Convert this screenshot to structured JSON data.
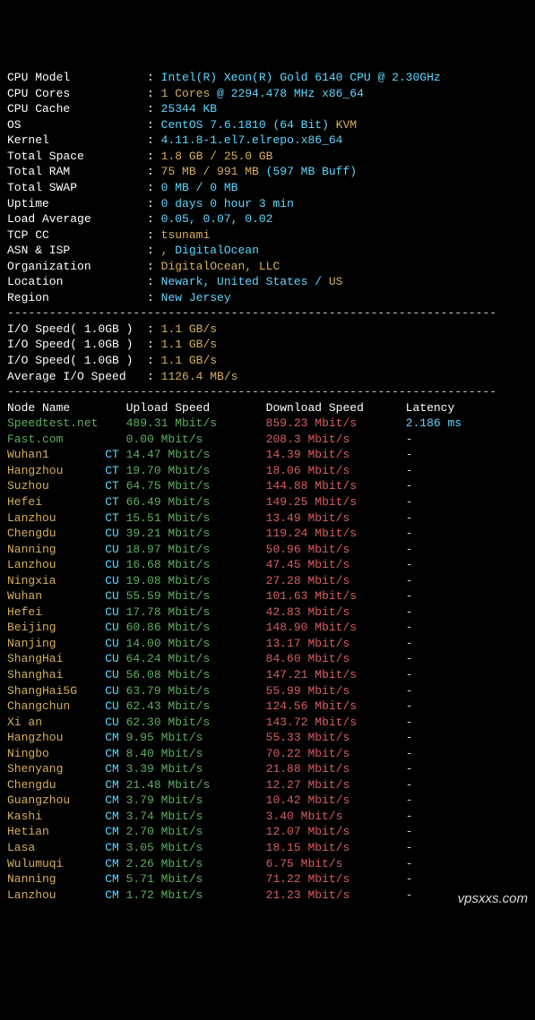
{
  "sysinfo": [
    {
      "label": "CPU Model",
      "val": [
        {
          "t": "Intel(R) Xeon(R) Gold 6140 CPU @ 2.30GHz",
          "c": "cyan"
        }
      ]
    },
    {
      "label": "CPU Cores",
      "val": [
        {
          "t": "1 Cores",
          "c": "yellow"
        },
        {
          "t": " @ 2294.478 MHz x86_64",
          "c": "cyan"
        }
      ]
    },
    {
      "label": "CPU Cache",
      "val": [
        {
          "t": "25344 KB",
          "c": "cyan"
        }
      ]
    },
    {
      "label": "OS",
      "val": [
        {
          "t": "CentOS 7.6.1810 (64 Bit)",
          "c": "cyan"
        },
        {
          "t": " KVM",
          "c": "yellow"
        }
      ]
    },
    {
      "label": "Kernel",
      "val": [
        {
          "t": "4.11.8-1.el7.elrepo.x86_64",
          "c": "cyan"
        }
      ]
    },
    {
      "label": "Total Space",
      "val": [
        {
          "t": "1.8 GB / 25.0 GB",
          "c": "yellow"
        }
      ]
    },
    {
      "label": "Total RAM",
      "val": [
        {
          "t": "75 MB / 991 MB",
          "c": "yellow"
        },
        {
          "t": " (597 MB Buff)",
          "c": "cyan"
        }
      ]
    },
    {
      "label": "Total SWAP",
      "val": [
        {
          "t": "0 MB / 0 MB",
          "c": "cyan"
        }
      ]
    },
    {
      "label": "Uptime",
      "val": [
        {
          "t": "0 days 0 hour 3 min",
          "c": "cyan"
        }
      ]
    },
    {
      "label": "Load Average",
      "val": [
        {
          "t": "0.05, 0.07, 0.02",
          "c": "cyan"
        }
      ]
    },
    {
      "label": "TCP CC",
      "val": [
        {
          "t": "tsunami",
          "c": "yellow"
        }
      ]
    },
    {
      "label": "ASN & ISP",
      "val": [
        {
          "t": ", ",
          "c": "yellow"
        },
        {
          "t": "DigitalOcean",
          "c": "cyan"
        }
      ]
    },
    {
      "label": "Organization",
      "val": [
        {
          "t": "DigitalOcean, LLC",
          "c": "yellow"
        }
      ]
    },
    {
      "label": "Location",
      "val": [
        {
          "t": "Newark, United States / ",
          "c": "cyan"
        },
        {
          "t": "US",
          "c": "yellow"
        }
      ]
    },
    {
      "label": "Region",
      "val": [
        {
          "t": "New Jersey",
          "c": "cyan"
        }
      ]
    }
  ],
  "io": {
    "rows": [
      {
        "label": "I/O Speed( 1.0GB )",
        "val": "1.1 GB/s"
      },
      {
        "label": "I/O Speed( 1.0GB )",
        "val": "1.1 GB/s"
      },
      {
        "label": "I/O Speed( 1.0GB )",
        "val": "1.1 GB/s"
      }
    ],
    "avg_label": "Average I/O Speed",
    "avg_val": "1126.4 MB/s"
  },
  "headers": {
    "node": "Node Name",
    "upload": "Upload Speed",
    "download": "Download Speed",
    "latency": "Latency"
  },
  "speed": [
    {
      "name": "Speedtest.net",
      "tag": "",
      "up": "489.31 Mbit/s",
      "down": "859.23 Mbit/s",
      "lat": "2.186 ms",
      "namec": "green",
      "latc": "cyan"
    },
    {
      "name": "Fast.com",
      "tag": "",
      "up": "0.00 Mbit/s",
      "down": "208.3 Mbit/s",
      "lat": "-",
      "namec": "green",
      "latc": "grey"
    },
    {
      "name": "Wuhan1",
      "tag": "CT",
      "up": "14.47 Mbit/s",
      "down": "14.39 Mbit/s",
      "lat": "-",
      "namec": "yellow",
      "latc": "grey"
    },
    {
      "name": "Hangzhou",
      "tag": "CT",
      "up": "19.70 Mbit/s",
      "down": "18.06 Mbit/s",
      "lat": "-",
      "namec": "yellow",
      "latc": "grey"
    },
    {
      "name": "Suzhou",
      "tag": "CT",
      "up": "64.75 Mbit/s",
      "down": "144.88 Mbit/s",
      "lat": "-",
      "namec": "yellow",
      "latc": "grey"
    },
    {
      "name": "Hefei",
      "tag": "CT",
      "up": "66.49 Mbit/s",
      "down": "149.25 Mbit/s",
      "lat": "-",
      "namec": "yellow",
      "latc": "grey"
    },
    {
      "name": "Lanzhou",
      "tag": "CT",
      "up": "15.51 Mbit/s",
      "down": "13.49 Mbit/s",
      "lat": "-",
      "namec": "yellow",
      "latc": "grey"
    },
    {
      "name": "Chengdu",
      "tag": "CU",
      "up": "39.21 Mbit/s",
      "down": "119.24 Mbit/s",
      "lat": "-",
      "namec": "yellow",
      "latc": "grey"
    },
    {
      "name": "Nanning",
      "tag": "CU",
      "up": "18.97 Mbit/s",
      "down": "50.96 Mbit/s",
      "lat": "-",
      "namec": "yellow",
      "latc": "grey"
    },
    {
      "name": "Lanzhou",
      "tag": "CU",
      "up": "16.68 Mbit/s",
      "down": "47.45 Mbit/s",
      "lat": "-",
      "namec": "yellow",
      "latc": "grey"
    },
    {
      "name": "Ningxia",
      "tag": "CU",
      "up": "19.08 Mbit/s",
      "down": "27.28 Mbit/s",
      "lat": "-",
      "namec": "yellow",
      "latc": "grey"
    },
    {
      "name": "Wuhan",
      "tag": "CU",
      "up": "55.59 Mbit/s",
      "down": "101.63 Mbit/s",
      "lat": "-",
      "namec": "yellow",
      "latc": "grey"
    },
    {
      "name": "Hefei",
      "tag": "CU",
      "up": "17.78 Mbit/s",
      "down": "42.83 Mbit/s",
      "lat": "-",
      "namec": "yellow",
      "latc": "grey"
    },
    {
      "name": "Beijing",
      "tag": "CU",
      "up": "60.86 Mbit/s",
      "down": "148.90 Mbit/s",
      "lat": "-",
      "namec": "yellow",
      "latc": "grey"
    },
    {
      "name": "Nanjing",
      "tag": "CU",
      "up": "14.00 Mbit/s",
      "down": "13.17 Mbit/s",
      "lat": "-",
      "namec": "yellow",
      "latc": "grey"
    },
    {
      "name": "ShangHai",
      "tag": "CU",
      "up": "64.24 Mbit/s",
      "down": "84.60 Mbit/s",
      "lat": "-",
      "namec": "yellow",
      "latc": "grey"
    },
    {
      "name": "Shanghai",
      "tag": "CU",
      "up": "56.08 Mbit/s",
      "down": "147.21 Mbit/s",
      "lat": "-",
      "namec": "yellow",
      "latc": "grey"
    },
    {
      "name": "ShangHai5G",
      "tag": "CU",
      "up": "63.79 Mbit/s",
      "down": "55.99 Mbit/s",
      "lat": "-",
      "namec": "yellow",
      "latc": "grey"
    },
    {
      "name": "Changchun",
      "tag": "CU",
      "up": "62.43 Mbit/s",
      "down": "124.56 Mbit/s",
      "lat": "-",
      "namec": "yellow",
      "latc": "grey"
    },
    {
      "name": "Xi an",
      "tag": "CU",
      "up": "62.30 Mbit/s",
      "down": "143.72 Mbit/s",
      "lat": "-",
      "namec": "yellow",
      "latc": "grey"
    },
    {
      "name": "Hangzhou",
      "tag": "CM",
      "up": "9.95 Mbit/s",
      "down": "55.33 Mbit/s",
      "lat": "-",
      "namec": "yellow",
      "latc": "grey"
    },
    {
      "name": "Ningbo",
      "tag": "CM",
      "up": "8.40 Mbit/s",
      "down": "70.22 Mbit/s",
      "lat": "-",
      "namec": "yellow",
      "latc": "grey"
    },
    {
      "name": "Shenyang",
      "tag": "CM",
      "up": "3.39 Mbit/s",
      "down": "21.88 Mbit/s",
      "lat": "-",
      "namec": "yellow",
      "latc": "grey"
    },
    {
      "name": "Chengdu",
      "tag": "CM",
      "up": "21.48 Mbit/s",
      "down": "12.27 Mbit/s",
      "lat": "-",
      "namec": "yellow",
      "latc": "grey"
    },
    {
      "name": "Guangzhou",
      "tag": "CM",
      "up": "3.79 Mbit/s",
      "down": "10.42 Mbit/s",
      "lat": "-",
      "namec": "yellow",
      "latc": "grey"
    },
    {
      "name": "Kashi",
      "tag": "CM",
      "up": "3.74 Mbit/s",
      "down": "3.40 Mbit/s",
      "lat": "-",
      "namec": "yellow",
      "latc": "grey"
    },
    {
      "name": "Hetian",
      "tag": "CM",
      "up": "2.70 Mbit/s",
      "down": "12.07 Mbit/s",
      "lat": "-",
      "namec": "yellow",
      "latc": "grey"
    },
    {
      "name": "Lasa",
      "tag": "CM",
      "up": "3.05 Mbit/s",
      "down": "18.15 Mbit/s",
      "lat": "-",
      "namec": "yellow",
      "latc": "grey"
    },
    {
      "name": "Wulumuqi",
      "tag": "CM",
      "up": "2.26 Mbit/s",
      "down": "6.75 Mbit/s",
      "lat": "-",
      "namec": "yellow",
      "latc": "grey"
    },
    {
      "name": "Nanning",
      "tag": "CM",
      "up": "5.71 Mbit/s",
      "down": "71.22 Mbit/s",
      "lat": "-",
      "namec": "yellow",
      "latc": "grey"
    },
    {
      "name": "Lanzhou",
      "tag": "CM",
      "up": "1.72 Mbit/s",
      "down": "21.23 Mbit/s",
      "lat": "-",
      "namec": "yellow",
      "latc": "grey"
    }
  ],
  "watermark": "vpsxxs.com"
}
